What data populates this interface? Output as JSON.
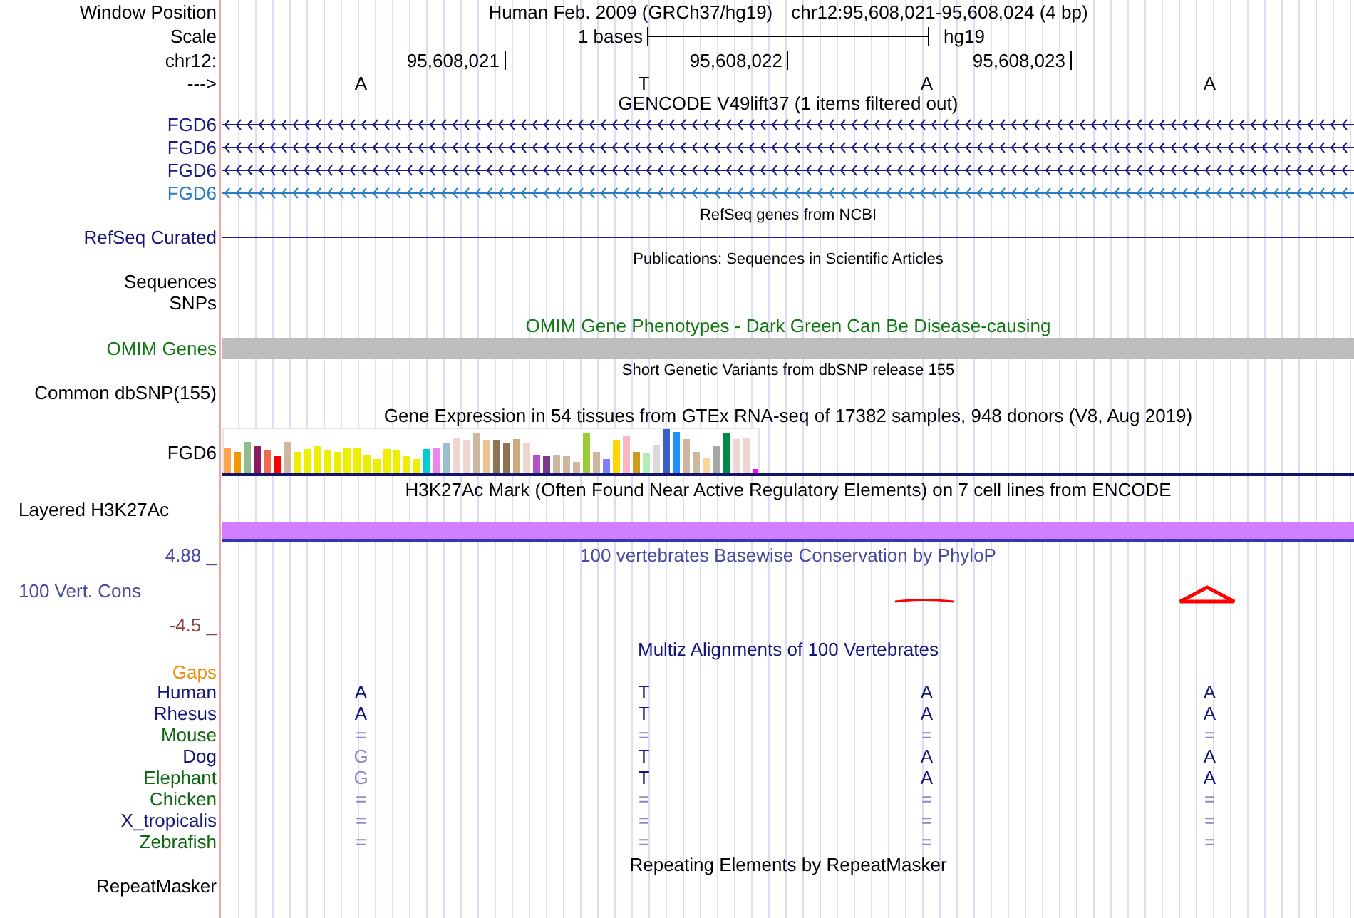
{
  "header": {
    "label": "Window Position",
    "assembly": "Human Feb. 2009 (GRCh37/hg19)",
    "position": "chr12:95,608,021-95,608,024 (4 bp)"
  },
  "scale": {
    "label": "Scale",
    "span": "1 bases",
    "assembly": "hg19"
  },
  "coordinates": {
    "label": "chr12:",
    "ticks": [
      "95,608,021",
      "95,608,022",
      "95,608,023"
    ]
  },
  "strand": {
    "label": "--->",
    "bases": [
      "A",
      "T",
      "A",
      "A"
    ]
  },
  "tracks": [
    {
      "kind": "genes",
      "title": "GENCODE V49lift37 (1 items filtered out)",
      "items": [
        {
          "label": "FGD6",
          "color": "#1a1a80"
        },
        {
          "label": "FGD6",
          "color": "#1a1a80"
        },
        {
          "label": "FGD6",
          "color": "#1a1a80"
        },
        {
          "label": "FGD6",
          "color": "#2a7bbf"
        }
      ]
    },
    {
      "kind": "line",
      "title": "RefSeq genes from NCBI",
      "label": "RefSeq Curated"
    },
    {
      "kind": "sparse",
      "title": "Publications: Sequences in Scientific Articles",
      "labels": [
        "Sequences",
        "SNPs"
      ]
    },
    {
      "kind": "block",
      "title": "OMIM Gene Phenotypes - Dark Green Can Be Disease-causing",
      "label": "OMIM Genes"
    },
    {
      "kind": "sparse",
      "title": "Short Genetic Variants from dbSNP release 155",
      "labels": [
        "Common dbSNP(155)"
      ]
    },
    {
      "kind": "expression",
      "title": "Gene Expression in 54 tissues from GTEx RNA-seq of 17382 samples, 948 donors (V8, Aug 2019)",
      "label": "FGD6"
    },
    {
      "kind": "layered",
      "title": "H3K27Ac Mark (Often Found Near Active Regulatory Elements) on 7 cell lines from ENCODE",
      "label": "Layered H3K27Ac"
    },
    {
      "kind": "conservation",
      "title": "100 vertebrates Basewise Conservation by PhyloP",
      "label": "100 Vert. Cons",
      "max": "4.88 _",
      "min": "-4.5 _"
    },
    {
      "kind": "alignment",
      "title": "Multiz Alignments of 100 Vertebrates",
      "gaps": "Gaps",
      "species": [
        {
          "name": "Human",
          "color": "#14147a",
          "bases": [
            {
              "base": "A",
              "dimmed": false
            },
            {
              "base": "T",
              "dimmed": false
            },
            {
              "base": "A",
              "dimmed": false
            },
            {
              "base": "A",
              "dimmed": false
            }
          ]
        },
        {
          "name": "Rhesus",
          "color": "#14147a",
          "bases": [
            {
              "base": "A",
              "dimmed": false
            },
            {
              "base": "T",
              "dimmed": false
            },
            {
              "base": "A",
              "dimmed": false
            },
            {
              "base": "A",
              "dimmed": false
            }
          ]
        },
        {
          "name": "Mouse",
          "color": "#116611",
          "bases": [
            {
              "base": "=",
              "dimmed": true
            },
            {
              "base": "=",
              "dimmed": true
            },
            {
              "base": "=",
              "dimmed": true
            },
            {
              "base": "=",
              "dimmed": true
            }
          ]
        },
        {
          "name": "Dog",
          "color": "#14147a",
          "bases": [
            {
              "base": "G",
              "dimmed": true
            },
            {
              "base": "T",
              "dimmed": false
            },
            {
              "base": "A",
              "dimmed": false
            },
            {
              "base": "A",
              "dimmed": false
            }
          ]
        },
        {
          "name": "Elephant",
          "color": "#116611",
          "bases": [
            {
              "base": "G",
              "dimmed": true
            },
            {
              "base": "T",
              "dimmed": false
            },
            {
              "base": "A",
              "dimmed": false
            },
            {
              "base": "A",
              "dimmed": false
            }
          ]
        },
        {
          "name": "Chicken",
          "color": "#116611",
          "bases": [
            {
              "base": "=",
              "dimmed": true
            },
            {
              "base": "=",
              "dimmed": true
            },
            {
              "base": "=",
              "dimmed": true
            },
            {
              "base": "=",
              "dimmed": true
            }
          ]
        },
        {
          "name": "X_tropicalis",
          "color": "#14147a",
          "bases": [
            {
              "base": "=",
              "dimmed": true
            },
            {
              "base": "=",
              "dimmed": true
            },
            {
              "base": "=",
              "dimmed": true
            },
            {
              "base": "=",
              "dimmed": true
            }
          ]
        },
        {
          "name": "Zebrafish",
          "color": "#116611",
          "bases": [
            {
              "base": "=",
              "dimmed": true
            },
            {
              "base": "=",
              "dimmed": true
            },
            {
              "base": "=",
              "dimmed": true
            },
            {
              "base": "=",
              "dimmed": true
            }
          ]
        }
      ]
    },
    {
      "kind": "plain",
      "title": "Repeating Elements by RepeatMasker",
      "label": "RepeatMasker"
    }
  ]
}
